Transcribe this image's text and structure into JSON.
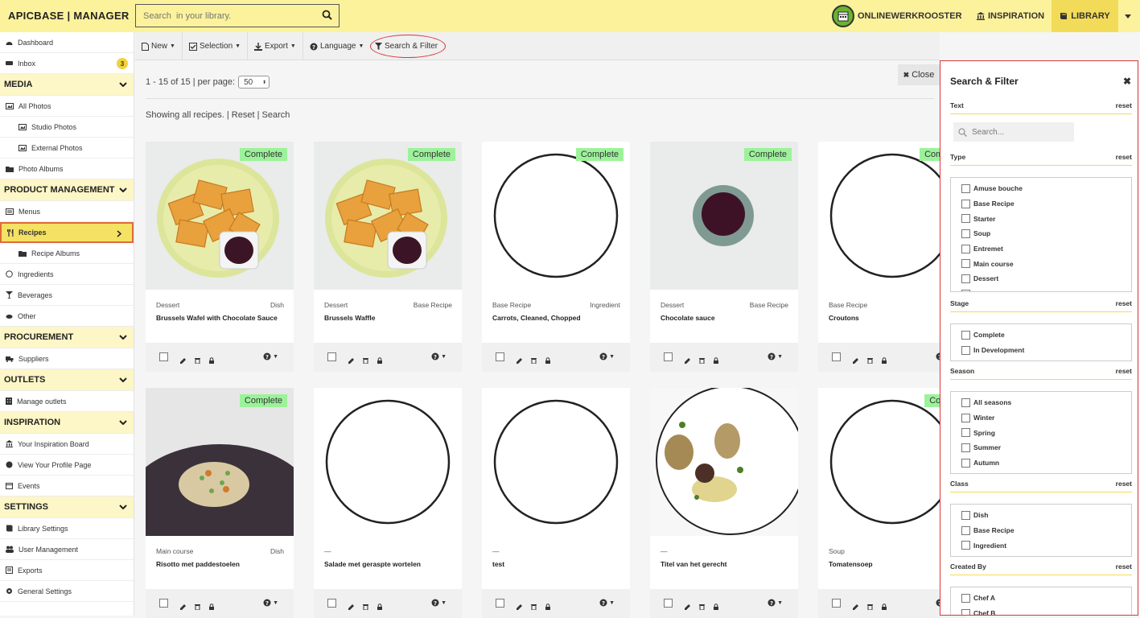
{
  "header": {
    "brand": "APICBASE | MANAGER",
    "search_placeholder": "Search  in your library.",
    "org_name": "ONLINEWERKROOSTER",
    "inspiration": "INSPIRATION",
    "library": "LIBRARY"
  },
  "sidebar": {
    "dashboard": "Dashboard",
    "inbox": "Inbox",
    "inbox_count": "3",
    "media": "MEDIA",
    "all_photos": "All Photos",
    "studio_photos": "Studio Photos",
    "external_photos": "External Photos",
    "photo_albums": "Photo Albums",
    "product_management": "PRODUCT MANAGEMENT",
    "menus": "Menus",
    "recipes": "Recipes",
    "recipe_albums": "Recipe Albums",
    "ingredients": "Ingredients",
    "beverages": "Beverages",
    "other": "Other",
    "procurement": "PROCUREMENT",
    "suppliers": "Suppliers",
    "outlets": "OUTLETS",
    "manage_outlets": "Manage outlets",
    "inspiration": "INSPIRATION",
    "inspiration_board": "Your Inspiration Board",
    "profile_page": "View Your Profile Page",
    "events": "Events",
    "settings": "SETTINGS",
    "library_settings": "Library Settings",
    "user_management": "User Management",
    "exports": "Exports",
    "general_settings": "General Settings"
  },
  "toolbar": {
    "new": "New",
    "selection": "Selection",
    "export": "Export",
    "language": "Language",
    "search_filter": "Search & Filter"
  },
  "content": {
    "pager_text": "1 - 15 of 15 | per page:",
    "per_page": "50",
    "showing": "Showing all recipes. | Reset | Search",
    "close": "Close"
  },
  "recipes": [
    {
      "category": "Dessert",
      "class": "Dish",
      "title": "Brussels Wafel with Chocolate Sauce",
      "stage": "Complete",
      "image": "waffle"
    },
    {
      "category": "Dessert",
      "class": "Base Recipe",
      "title": "Brussels Waffle",
      "stage": "Complete",
      "image": "waffle"
    },
    {
      "category": "Base Recipe",
      "class": "Ingredient",
      "title": "Carrots, Cleaned, Chopped",
      "stage": "Complete",
      "image": "empty"
    },
    {
      "category": "Dessert",
      "class": "Base Recipe",
      "title": "Chocolate sauce",
      "stage": "Complete",
      "image": "sauce"
    },
    {
      "category": "Base Recipe",
      "class": "Ingre",
      "title": "Croutons",
      "stage": "Comple",
      "image": "empty"
    },
    {
      "category": "Main course",
      "class": "Dish",
      "title": "Risotto met paddestoelen",
      "stage": "Complete",
      "image": "risotto"
    },
    {
      "category": "—",
      "class": "",
      "title": "Salade met geraspte wortelen",
      "stage": "",
      "image": "empty"
    },
    {
      "category": "—",
      "class": "",
      "title": "test",
      "stage": "",
      "image": "empty"
    },
    {
      "category": "—",
      "class": "",
      "title": "Titel van het gerecht",
      "stage": "",
      "image": "fig"
    },
    {
      "category": "Soup",
      "class": "",
      "title": "Tomatensoep",
      "stage": "Compl",
      "image": "empty"
    }
  ],
  "filter": {
    "title": "Search & Filter",
    "reset": "reset",
    "text_label": "Text",
    "search_placeholder": "Search...",
    "type_label": "Type",
    "types": [
      "Amuse bouche",
      "Base Recipe",
      "Starter",
      "Soup",
      "Entremet",
      "Main course",
      "Dessert",
      "Other"
    ],
    "stage_label": "Stage",
    "stages": [
      "Complete",
      "In Development"
    ],
    "season_label": "Season",
    "seasons": [
      "All seasons",
      "Winter",
      "Spring",
      "Summer",
      "Autumn"
    ],
    "class_label": "Class",
    "classes": [
      "Dish",
      "Base Recipe",
      "Ingredient"
    ],
    "created_label": "Created By",
    "creators": [
      "Chef A",
      "Chef B"
    ]
  },
  "colors": {
    "header_yellow": "#fcf29c",
    "section_yellow": "#fdf6c6",
    "active_yellow": "#f5e163",
    "highlight_red": "#d93838",
    "tag_green": "#9cf29a"
  }
}
